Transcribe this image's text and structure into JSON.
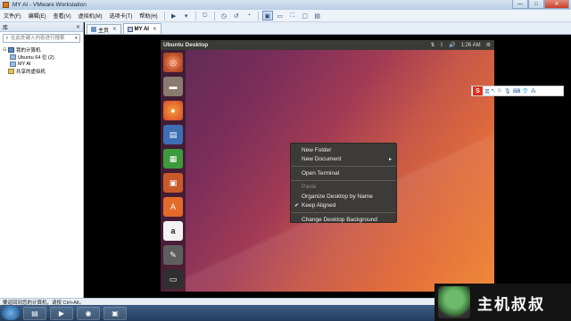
{
  "window": {
    "title": "MY AI - VMware Workstation",
    "minimize": "—",
    "maximize": "□",
    "close": "✕"
  },
  "menu": [
    "文件(F)",
    "编辑(E)",
    "查看(V)",
    "虚拟机(M)",
    "选项卡(T)",
    "帮助(H)"
  ],
  "sidebar": {
    "header": "库",
    "close": "✕",
    "search_placeholder": "在此处键入内容进行搜索",
    "tree": {
      "my_computer": "我的计算机",
      "ubuntu": "Ubuntu 64 位 (2)",
      "myai": "MY AI",
      "shared": "共享的虚拟机"
    }
  },
  "tabs": [
    {
      "label": "主页",
      "close": "✕"
    },
    {
      "label": "MY AI",
      "close": "✕"
    }
  ],
  "ubuntu": {
    "title": "Ubuntu Desktop",
    "time": "1:26 AM",
    "launcher_amazon": "a"
  },
  "context_menu": {
    "new_folder": "New Folder",
    "new_document": "New Document",
    "open_terminal": "Open Terminal",
    "paste": "Paste",
    "organize": "Organize Desktop by Name",
    "keep_aligned": "Keep Aligned",
    "change_bg": "Change Desktop Background",
    "check": "✔",
    "arrow": "▸"
  },
  "ime": {
    "logo": "S",
    "mode": "英"
  },
  "statusbar": {
    "text": "要返回到您的计算机，请按 Ctrl+Alt。"
  },
  "watermark": {
    "text": "主机叔叔"
  }
}
